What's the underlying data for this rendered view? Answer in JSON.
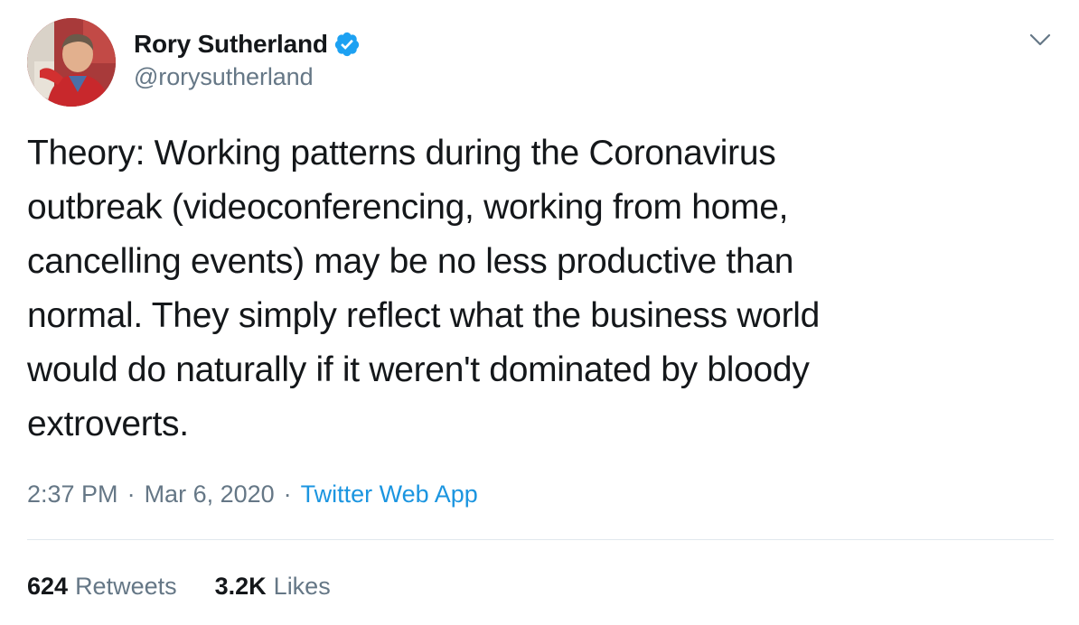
{
  "author": {
    "display_name": "Rory Sutherland",
    "handle": "@rorysutherland",
    "verified_icon": "verified-badge-icon",
    "avatar": "avatar-photo"
  },
  "menu_icon": "chevron-down-icon",
  "tweet": {
    "text": "Theory: Working patterns during the Coronavirus\noutbreak (videoconferencing, working from home,\ncancelling events) may be no less productive than\nnormal. They simply reflect what the business world\nwould do naturally if it weren't dominated by bloody\nextroverts."
  },
  "meta": {
    "time": "2:37 PM",
    "separator": "·",
    "date": "Mar 6, 2020",
    "source": "Twitter Web App"
  },
  "stats": {
    "retweets_count": "624",
    "retweets_label": "Retweets",
    "likes_count": "3.2K",
    "likes_label": "Likes"
  },
  "colors": {
    "text_primary": "#14171a",
    "text_secondary": "#657786",
    "link_blue": "#1b95e0",
    "verified_blue": "#1da1f2",
    "divider": "#e1e8ed"
  }
}
